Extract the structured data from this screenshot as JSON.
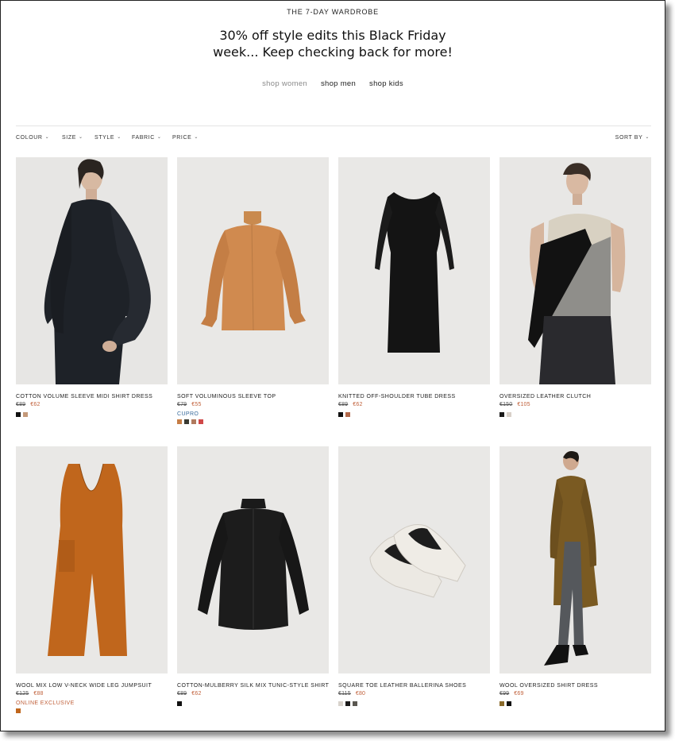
{
  "header": {
    "eyebrow": "THE 7-DAY WARDROBE",
    "headline_line1": "30% off style edits this Black Friday",
    "headline_line2": "week... Keep checking back for more!"
  },
  "shop_links": [
    {
      "label": "shop women",
      "active": true
    },
    {
      "label": "shop men",
      "active": false
    },
    {
      "label": "shop kids",
      "active": false
    }
  ],
  "filters": {
    "colour": "COLOUR",
    "size": "SIZE",
    "style": "STYLE",
    "fabric": "FABRIC",
    "price": "PRICE",
    "sort": "SORT BY"
  },
  "colors": {
    "sale_price": "#c0603a",
    "tag_blue": "#3a6b9c",
    "tag_orange": "#c0603a",
    "image_bg": "#eae9e7"
  },
  "products": [
    {
      "name": "COTTON VOLUME SLEEVE MIDI SHIRT DRESS",
      "old_price": "€89",
      "new_price": "€62",
      "tag": "",
      "swatches": [
        "#111111",
        "#c49a7a"
      ]
    },
    {
      "name": "SOFT VOLUMINOUS SLEEVE TOP",
      "old_price": "€79",
      "new_price": "€55",
      "tag": "CUPRO",
      "swatches": [
        "#c67d45",
        "#3a3a32",
        "#b07a5e",
        "#d04848"
      ]
    },
    {
      "name": "KNITTED OFF-SHOULDER TUBE DRESS",
      "old_price": "€89",
      "new_price": "€62",
      "tag": "",
      "swatches": [
        "#111111",
        "#b2684a"
      ]
    },
    {
      "name": "OVERSIZED LEATHER CLUTCH",
      "old_price": "€150",
      "new_price": "€105",
      "tag": "",
      "swatches": [
        "#1a1a1a",
        "#d8d0c8"
      ]
    },
    {
      "name": "WOOL MIX LOW V-NECK WIDE LEG JUMPSUIT",
      "old_price": "€125",
      "new_price": "€88",
      "tag": "ONLINE EXCLUSIVE",
      "swatches": [
        "#c0661c"
      ]
    },
    {
      "name": "COTTON-MULBERRY SILK MIX TUNIC-STYLE SHIRT",
      "old_price": "€89",
      "new_price": "€62",
      "tag": "",
      "swatches": [
        "#111111"
      ]
    },
    {
      "name": "SQUARE TOE LEATHER BALLERINA SHOES",
      "old_price": "€115",
      "new_price": "€80",
      "tag": "",
      "swatches": [
        "#d8d3cc",
        "#1a1a1a",
        "#5a5750"
      ]
    },
    {
      "name": "WOOL OVERSIZED SHIRT DRESS",
      "old_price": "€99",
      "new_price": "€69",
      "tag": "",
      "swatches": [
        "#8a6a2a",
        "#111111"
      ]
    }
  ]
}
